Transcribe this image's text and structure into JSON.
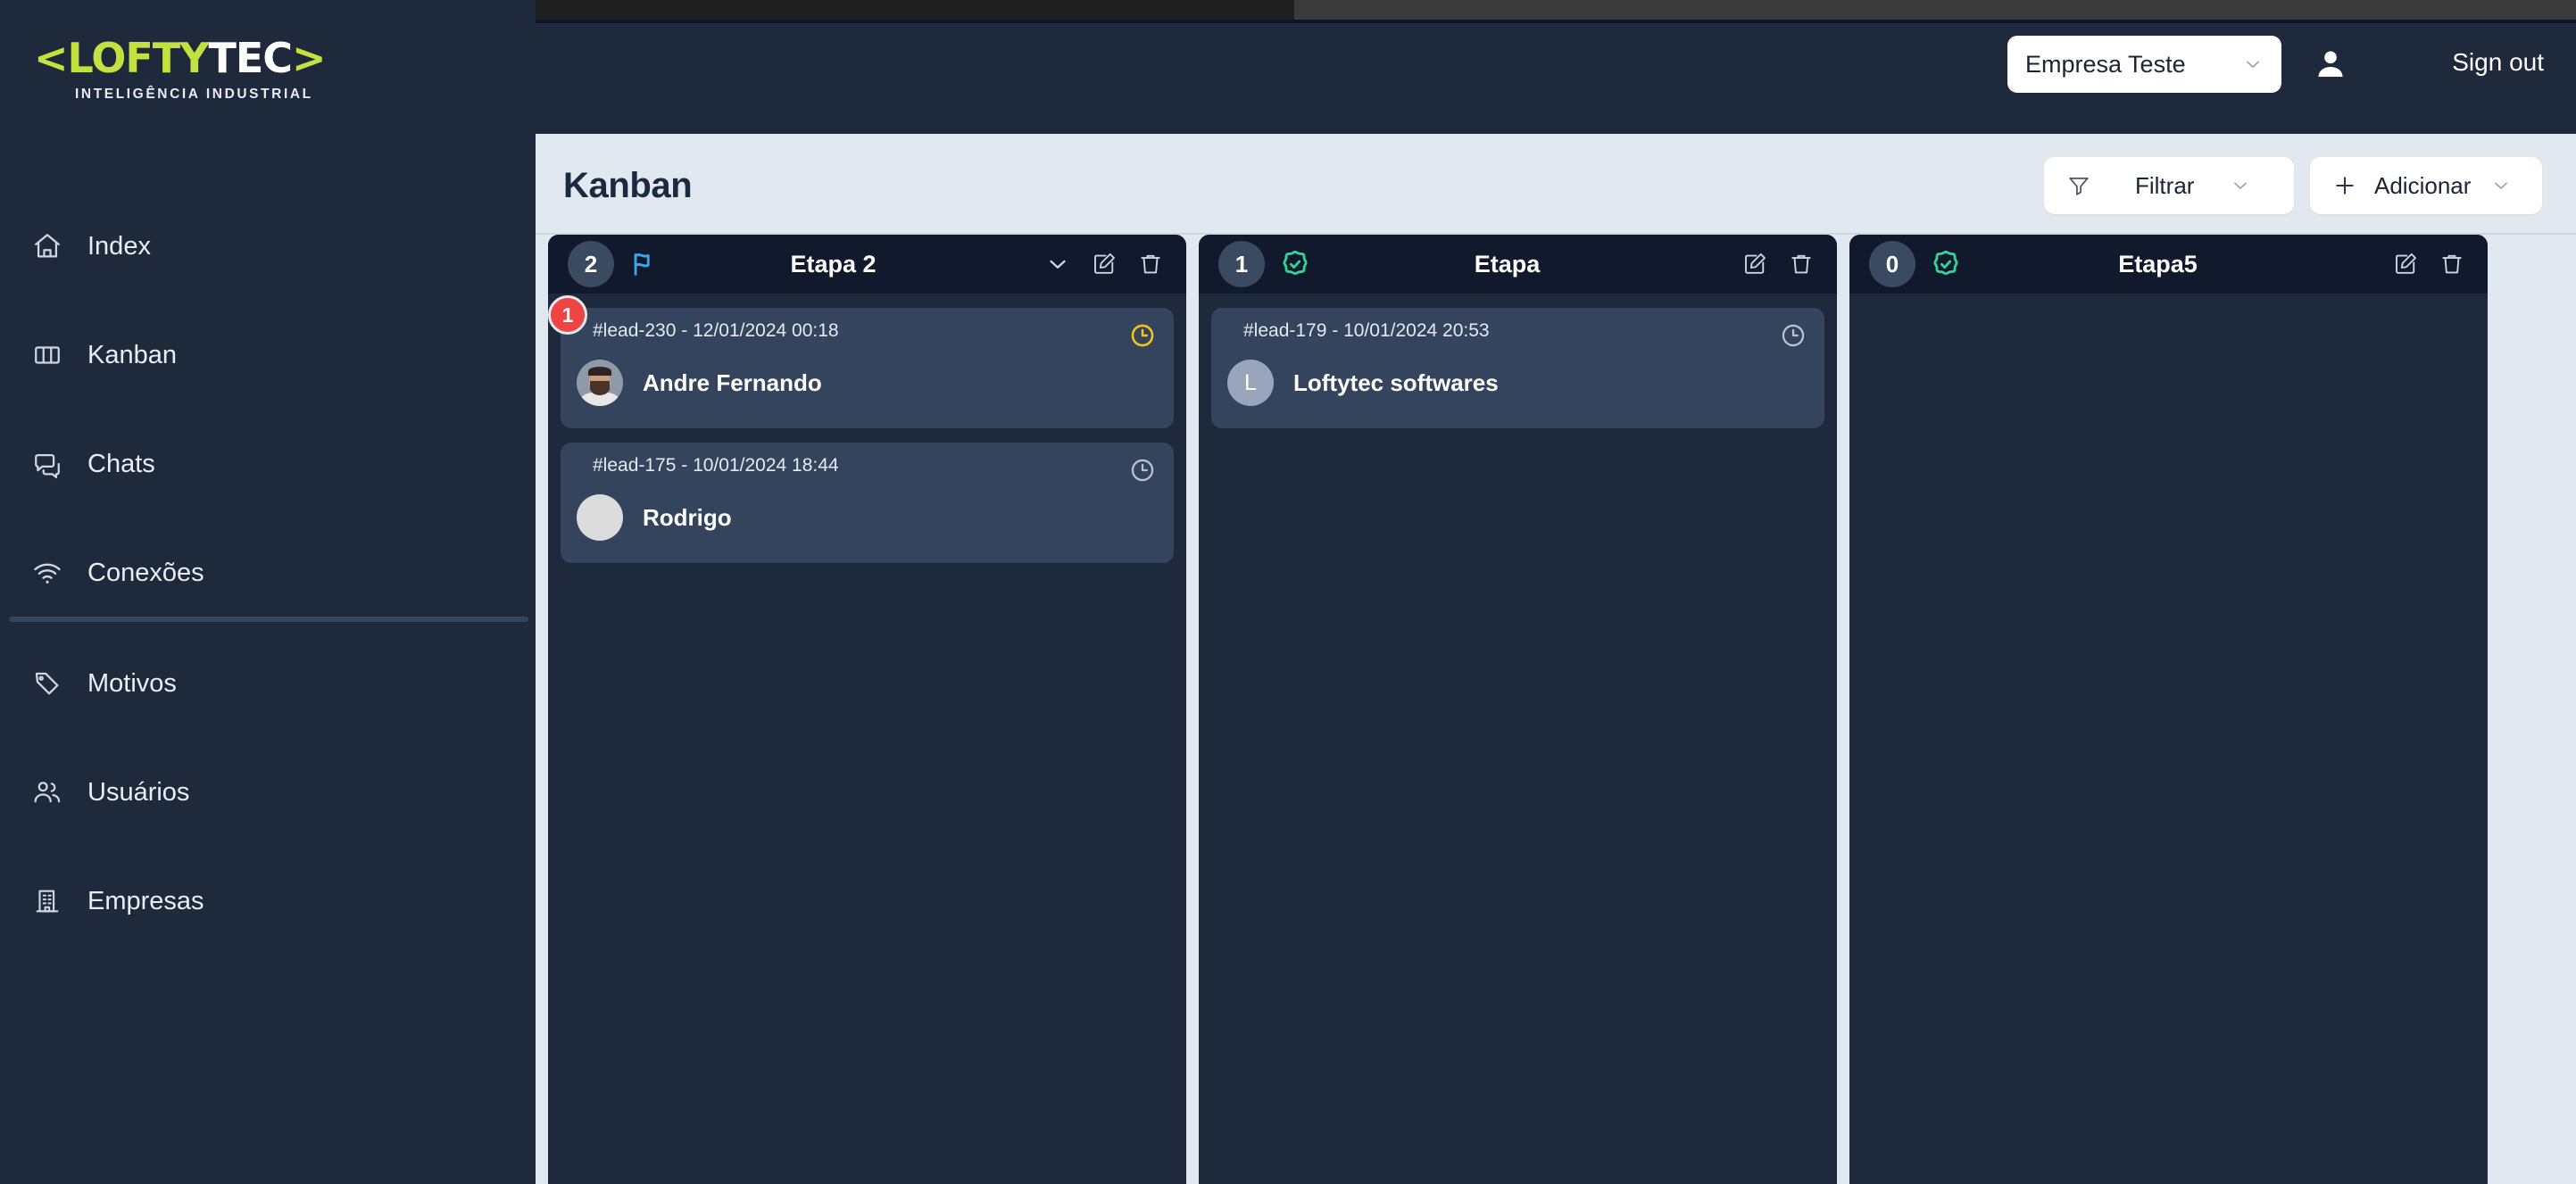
{
  "brand": {
    "logo_chev_left": "<",
    "logo_lofty": "LOFTY",
    "logo_tec": "TEC",
    "logo_chev_right": ">",
    "tagline": "INTELIGÊNCIA INDUSTRIAL"
  },
  "sidebar": {
    "top_items": [
      {
        "label": "Index",
        "icon": "home-icon"
      },
      {
        "label": "Kanban",
        "icon": "columns-icon"
      },
      {
        "label": "Chats",
        "icon": "chat-icon"
      },
      {
        "label": "Conexões",
        "icon": "wifi-icon"
      }
    ],
    "bottom_items": [
      {
        "label": "Motivos",
        "icon": "tag-icon"
      },
      {
        "label": "Usuários",
        "icon": "users-icon"
      },
      {
        "label": "Empresas",
        "icon": "building-icon"
      }
    ]
  },
  "topbar": {
    "company_selected": "Empresa Teste",
    "account_icon": "person-icon",
    "signout_label": "Sign out"
  },
  "header": {
    "title": "Kanban",
    "filter_button": {
      "label": "Filtrar",
      "icon": "funnel-icon",
      "chevron": "chevron-down-icon"
    },
    "add_button": {
      "label": "Adicionar",
      "icon": "plus-icon",
      "chevron": "chevron-down-icon"
    }
  },
  "colors": {
    "sidebar_bg": "#1e293b",
    "content_bg": "#e2e8f0",
    "column_bg": "#1e293b",
    "column_header_bg": "#111a2c",
    "card_bg": "#33445c",
    "accent_green": "#c3e23f",
    "flag_blue": "#38a8e8",
    "status_green": "#34d399",
    "badge_red": "#ef4444",
    "clock_yellow": "#f5c518",
    "clock_gray": "#b9c2ce"
  },
  "board": {
    "columns": [
      {
        "count": "2",
        "status_icon": "flag-icon",
        "status_color": "#38a8e8",
        "title": "Etapa 2",
        "has_collapse": true,
        "collapse_icon": "chevron-down-icon",
        "edit_icon": "edit-icon",
        "delete_icon": "trash-icon",
        "cards": [
          {
            "ref": "#lead-230 - 12/01/2024 00:18",
            "name": "Andre Fernando",
            "avatar_type": "photo",
            "avatar_initial": "",
            "clock_icon": "clock-icon",
            "clock_color": "#f5c518",
            "badge": "1"
          },
          {
            "ref": "#lead-175 - 10/01/2024 18:44",
            "name": "Rodrigo",
            "avatar_type": "blank",
            "avatar_initial": "",
            "clock_icon": "clock-icon",
            "clock_color": "#b9c2ce",
            "badge": ""
          }
        ]
      },
      {
        "count": "1",
        "status_icon": "check-badge-icon",
        "status_color": "#34d399",
        "title": "Etapa",
        "has_collapse": false,
        "collapse_icon": "",
        "edit_icon": "edit-icon",
        "delete_icon": "trash-icon",
        "cards": [
          {
            "ref": "#lead-179 - 10/01/2024 20:53",
            "name": "Loftytec softwares",
            "avatar_type": "initial",
            "avatar_initial": "L",
            "clock_icon": "clock-icon",
            "clock_color": "#b9c2ce",
            "badge": ""
          }
        ]
      },
      {
        "count": "0",
        "status_icon": "check-badge-icon",
        "status_color": "#34d399",
        "title": "Etapa5",
        "has_collapse": false,
        "collapse_icon": "",
        "edit_icon": "edit-icon",
        "delete_icon": "trash-icon",
        "cards": []
      }
    ]
  }
}
